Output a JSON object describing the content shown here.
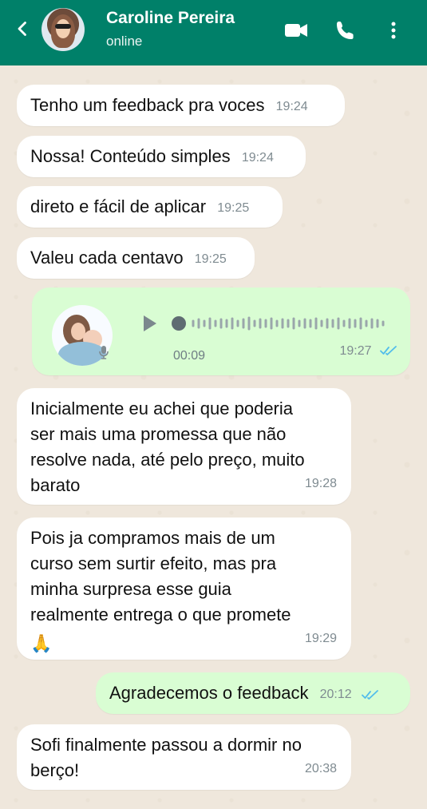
{
  "header": {
    "contact_name": "Caroline Pereira",
    "status": "online"
  },
  "icons": {
    "back": "back-arrow-icon",
    "video": "video-call-icon",
    "call": "phone-call-icon",
    "menu": "more-options-icon",
    "play": "play-icon",
    "mic": "microphone-icon",
    "read": "double-check-icon"
  },
  "colors": {
    "header": "#008069",
    "incoming": "#ffffff",
    "outgoing": "#d9fdd3",
    "read_ticks": "#53bdeb"
  },
  "messages": [
    {
      "type": "text",
      "direction": "incoming",
      "text": "Tenho um feedback pra voces",
      "time": "19:24"
    },
    {
      "type": "text",
      "direction": "incoming",
      "text": "Nossa! Conteúdo simples",
      "time": "19:24"
    },
    {
      "type": "text",
      "direction": "incoming",
      "text": "direto e fácil de aplicar",
      "time": "19:25"
    },
    {
      "type": "text",
      "direction": "incoming",
      "text": "Valeu cada centavo",
      "time": "19:25"
    },
    {
      "type": "audio",
      "direction": "outgoing",
      "duration": "00:09",
      "time": "19:27",
      "read": true
    },
    {
      "type": "text",
      "direction": "incoming",
      "lines": [
        "Inicialmente eu achei que poderia",
        "ser mais uma promessa que não",
        "resolve nada, até pelo preço, muito",
        "barato"
      ],
      "time": "19:28"
    },
    {
      "type": "text",
      "direction": "incoming",
      "lines": [
        "Pois ja compramos mais de um",
        "curso sem surtir efeito, mas pra",
        "minha surpresa esse guia",
        "realmente entrega o que promete"
      ],
      "emoji": "🙏",
      "time": "19:29"
    },
    {
      "type": "text",
      "direction": "outgoing",
      "text": "Agradecemos o feedback",
      "time": "20:12",
      "read": true
    },
    {
      "type": "text",
      "direction": "incoming",
      "lines": [
        "Sofi finalmente passou a dormir no",
        "berço!"
      ],
      "time": "20:38"
    }
  ]
}
